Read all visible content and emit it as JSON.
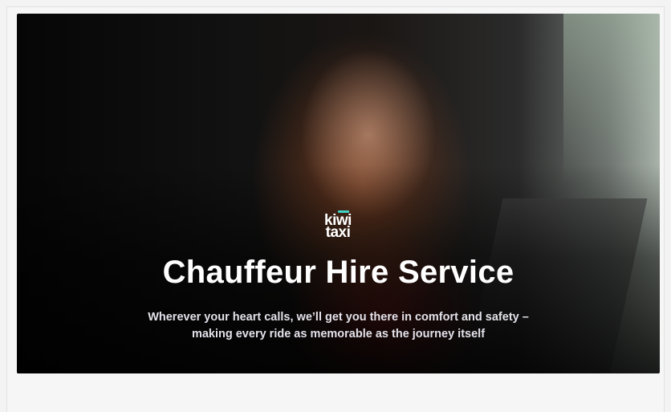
{
  "hero": {
    "image_icon": "woman-in-car-photo",
    "logo": {
      "line1": "kiwi",
      "line2": "taxi",
      "accent_color": "#3fd6c8"
    },
    "title": "Chauffeur Hire Service",
    "subtitle_line1": "Wherever your heart calls, we’ll get you there in comfort and safety –",
    "subtitle_line2": "making every ride as memorable as the journey itself"
  }
}
